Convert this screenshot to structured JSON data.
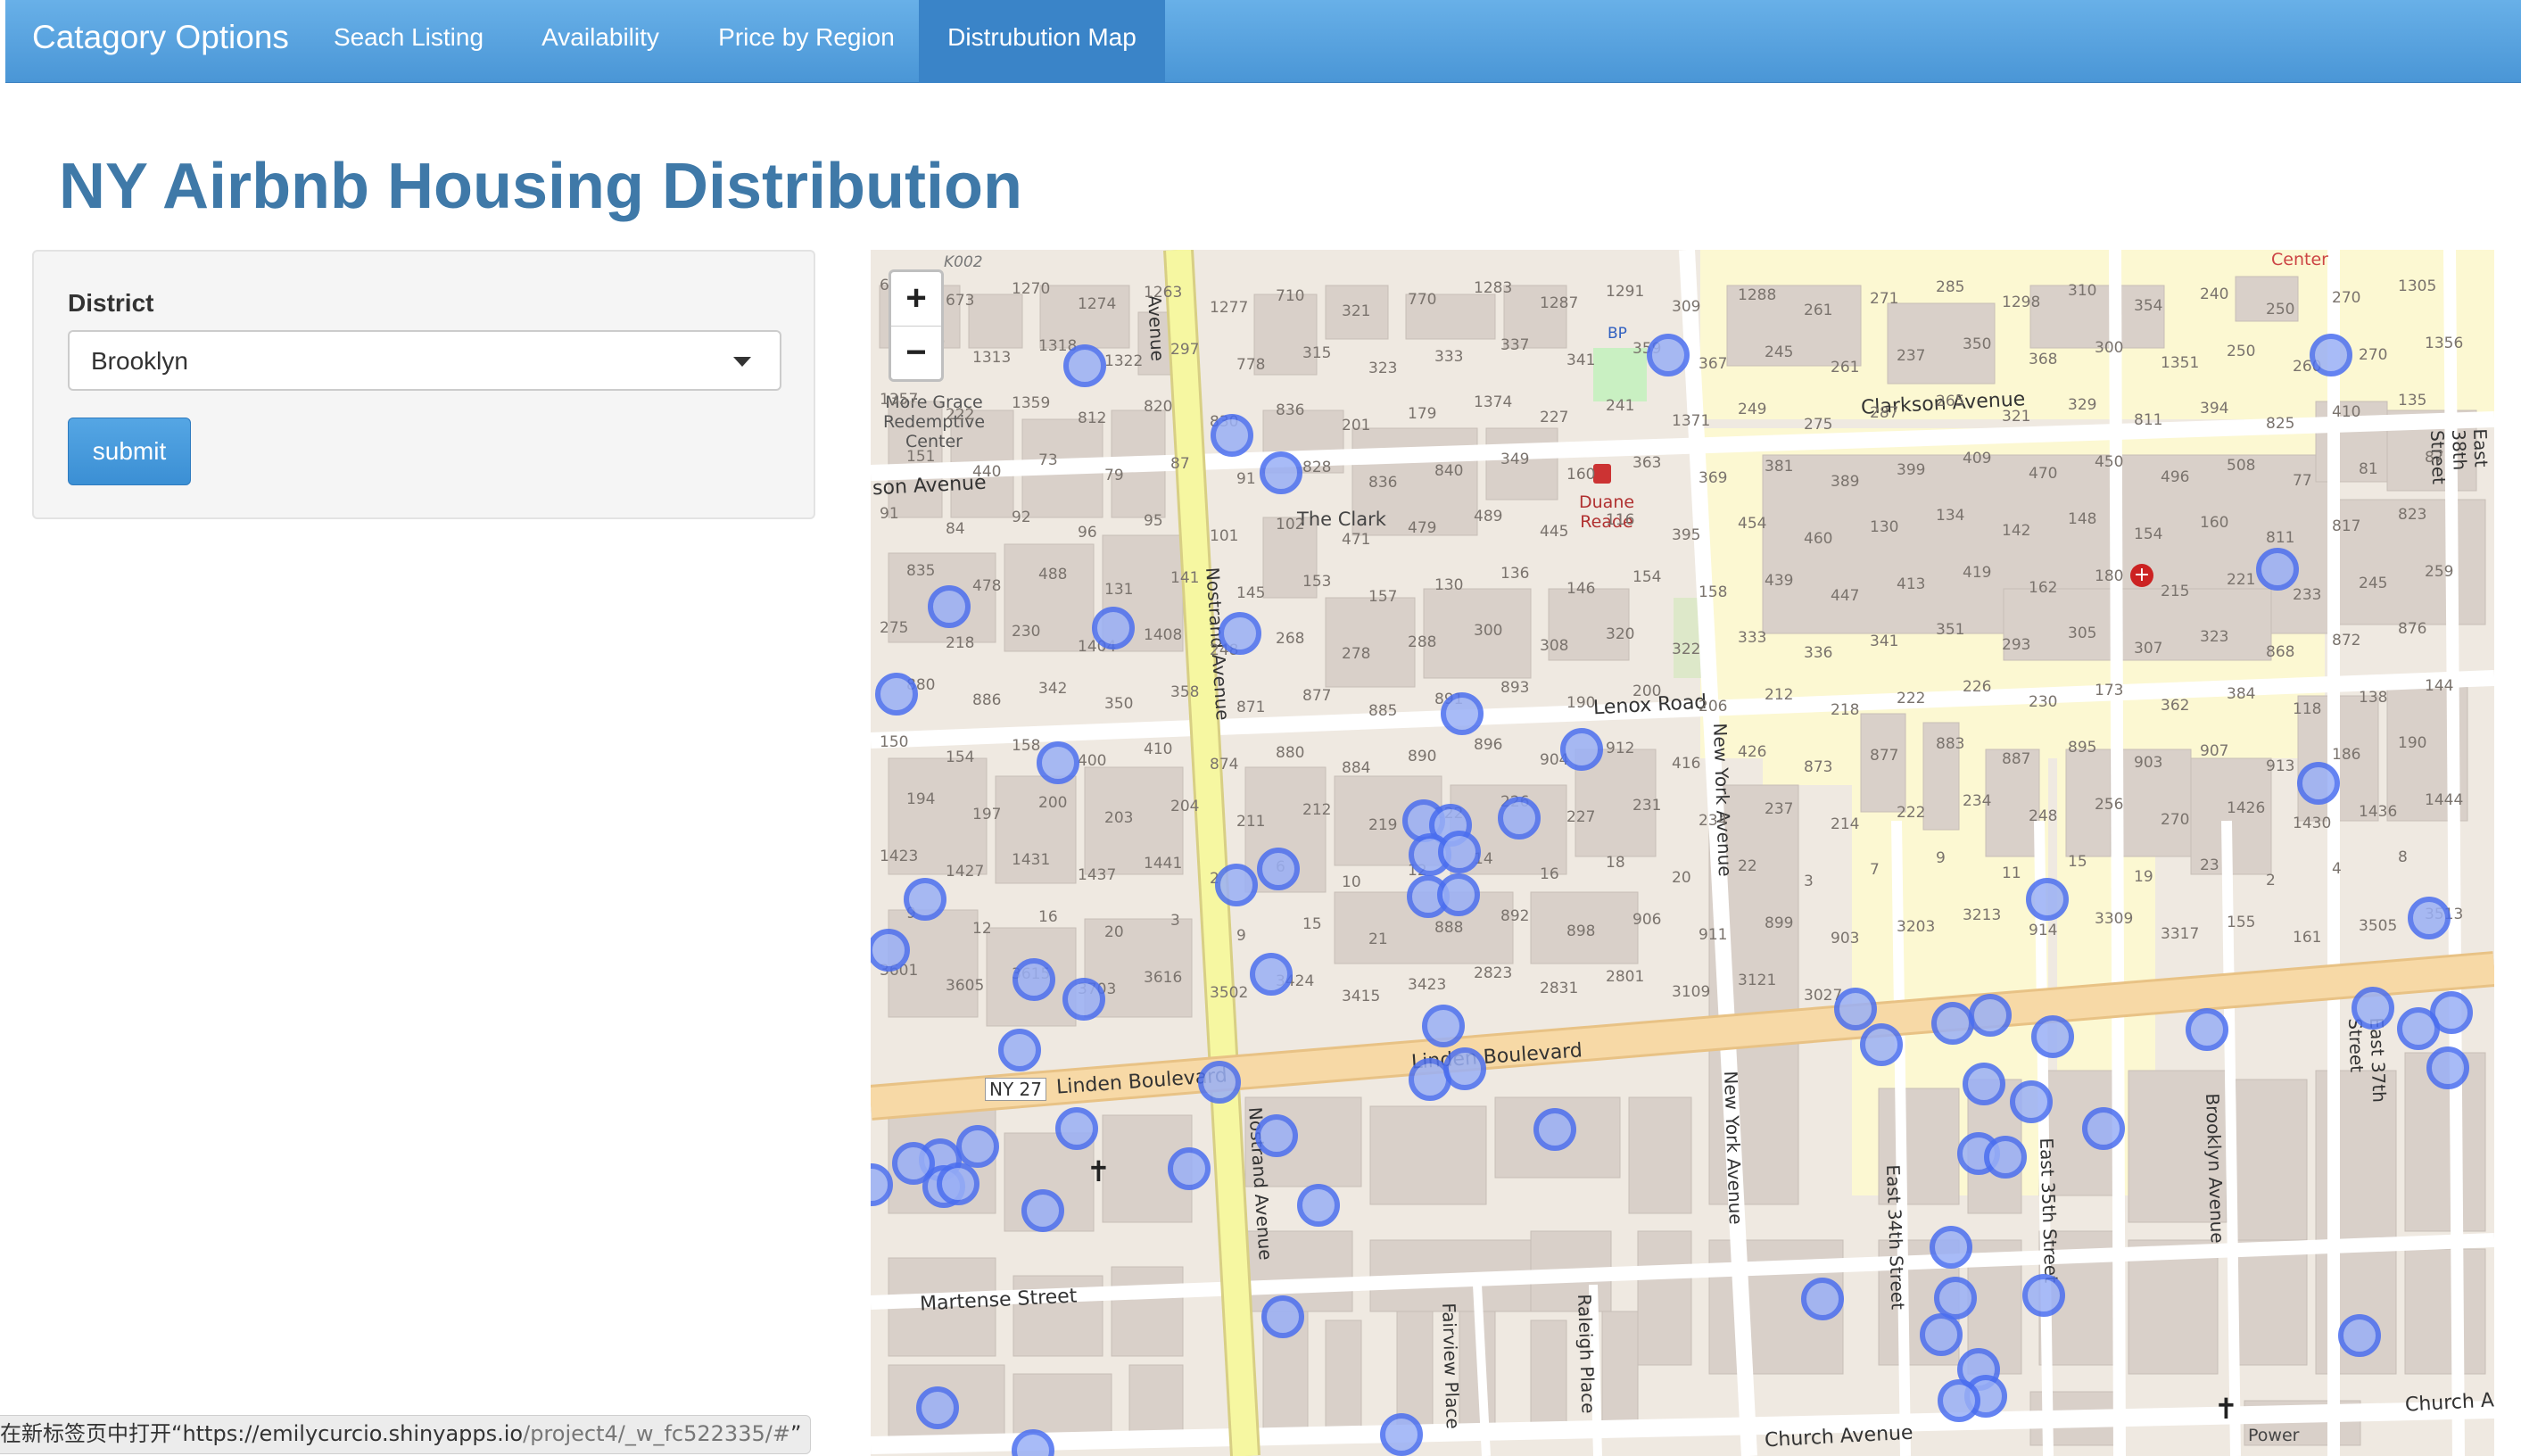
{
  "navbar": {
    "brand": "Catagory Options",
    "items": [
      {
        "label": "Seach Listing",
        "active": false
      },
      {
        "label": "Availability",
        "active": false
      },
      {
        "label": "Price by Region",
        "active": false
      },
      {
        "label": "Distrubution Map",
        "active": true
      }
    ]
  },
  "page": {
    "title": "NY Airbnb Housing Distribution"
  },
  "sidebar": {
    "district_label": "District",
    "district_value": "Brooklyn",
    "submit_label": "submit"
  },
  "map": {
    "zoom_in": "+",
    "zoom_out": "−",
    "streets": {
      "clarkson": "Clarkson Avenue",
      "clarkson_left": "son Avenue",
      "lenox": "Lenox Road",
      "linden": "Linden Boulevard",
      "linden_left": "Linden Boulevard",
      "ny27": "NY 27",
      "martense": "Martense Street",
      "church": "Church Avenue",
      "church_right": "Church A",
      "nostrand": "Nostrand Avenue",
      "nostrand_lower": "Nostrand Avenue",
      "nostrand_top": "Avenue",
      "new_york": "New York Avenue",
      "new_york_lower": "New York Avenue",
      "e34": "East 34th Street",
      "e35": "East 35th Street",
      "brooklyn_ave": "Brooklyn Avenue",
      "e37": "East 37th Street",
      "e38": "East 38th Street",
      "fairview": "Fairview Place",
      "raleigh": "Raleigh Place",
      "enue": "enue"
    },
    "places": {
      "grace": [
        "More Grace",
        "Redemptive",
        "Center"
      ],
      "clark": "The Clark",
      "duane": [
        "Duane",
        "Reade"
      ],
      "center": "Center",
      "bp": "BP",
      "power": "Power",
      "k002": "K002"
    },
    "house_numbers": [
      "670",
      "673",
      "1270",
      "1274",
      "1263",
      "1277",
      "710",
      "321",
      "770",
      "1283",
      "1287",
      "1291",
      "309",
      "1288",
      "261",
      "271",
      "285",
      "1298",
      "310",
      "354",
      "240",
      "250",
      "270",
      "1305",
      "1309",
      "1313",
      "1318",
      "1322",
      "297",
      "778",
      "315",
      "323",
      "333",
      "337",
      "341",
      "359",
      "367",
      "245",
      "261",
      "237",
      "350",
      "368",
      "300",
      "1351",
      "250",
      "260",
      "270",
      "1356",
      "1357",
      "222",
      "1359",
      "812",
      "820",
      "830",
      "836",
      "201",
      "179",
      "1374",
      "227",
      "241",
      "1371",
      "249",
      "275",
      "287",
      "265",
      "321",
      "329",
      "811",
      "394",
      "825",
      "410",
      "135",
      "151",
      "440",
      "73",
      "79",
      "87",
      "91",
      "828",
      "836",
      "840",
      "349",
      "160",
      "363",
      "369",
      "381",
      "389",
      "399",
      "409",
      "470",
      "450",
      "496",
      "508",
      "77",
      "81",
      "87",
      "91",
      "84",
      "92",
      "96",
      "95",
      "101",
      "102",
      "471",
      "479",
      "489",
      "445",
      "116",
      "395",
      "454",
      "460",
      "130",
      "134",
      "142",
      "148",
      "154",
      "160",
      "811",
      "817",
      "823",
      "835",
      "478",
      "488",
      "131",
      "141",
      "145",
      "153",
      "157",
      "130",
      "136",
      "146",
      "154",
      "158",
      "439",
      "447",
      "413",
      "419",
      "162",
      "180",
      "215",
      "221",
      "233",
      "245",
      "259",
      "275",
      "218",
      "230",
      "1404",
      "1408",
      "248",
      "268",
      "278",
      "288",
      "300",
      "308",
      "320",
      "322",
      "333",
      "336",
      "341",
      "351",
      "293",
      "305",
      "307",
      "323",
      "868",
      "872",
      "876",
      "880",
      "886",
      "342",
      "350",
      "358",
      "871",
      "877",
      "885",
      "891",
      "893",
      "190",
      "200",
      "206",
      "212",
      "218",
      "222",
      "226",
      "230",
      "173",
      "362",
      "384",
      "118",
      "138",
      "144",
      "150",
      "154",
      "158",
      "400",
      "410",
      "874",
      "880",
      "884",
      "890",
      "896",
      "904",
      "912",
      "416",
      "426",
      "873",
      "877",
      "883",
      "887",
      "895",
      "903",
      "907",
      "913",
      "186",
      "190",
      "194",
      "197",
      "200",
      "203",
      "204",
      "211",
      "212",
      "219",
      "222",
      "226",
      "227",
      "231",
      "234",
      "237",
      "214",
      "222",
      "234",
      "248",
      "256",
      "270",
      "1426",
      "1430",
      "1436",
      "1444",
      "1423",
      "1427",
      "1431",
      "1437",
      "1441",
      "2",
      "6",
      "10",
      "12",
      "14",
      "16",
      "18",
      "20",
      "22",
      "3",
      "7",
      "9",
      "11",
      "15",
      "19",
      "23",
      "2",
      "4",
      "8",
      "9",
      "12",
      "16",
      "20",
      "3",
      "9",
      "15",
      "21",
      "888",
      "892",
      "898",
      "906",
      "911",
      "899",
      "903",
      "3203",
      "3213",
      "914",
      "3309",
      "3317",
      "155",
      "161",
      "3505",
      "3513",
      "3601",
      "3605",
      "3615",
      "3703",
      "3616",
      "3502",
      "3424",
      "3415",
      "3423",
      "2823",
      "2831",
      "2801",
      "3109",
      "3121",
      "3027"
    ]
  },
  "status_bar": {
    "prefix": "在新标签页中打开“",
    "url_main": "https://emilycurcio.shinyapps.io",
    "url_rest": "/project4/_w_fc522335/#",
    "suffix": "”"
  },
  "colors": {
    "navbar": "#4a96d6",
    "navbar_active": "#3a84c8",
    "title": "#3f79a8",
    "button": "#3b8fd4",
    "marker_stroke": "#4a6ef0",
    "marker_fill": "#9ab0f6",
    "major_road": "#f7d9a6",
    "avenue": "#f6f7a1",
    "building": "#d9d0c9",
    "hospital_area": "#fcf8d2"
  }
}
